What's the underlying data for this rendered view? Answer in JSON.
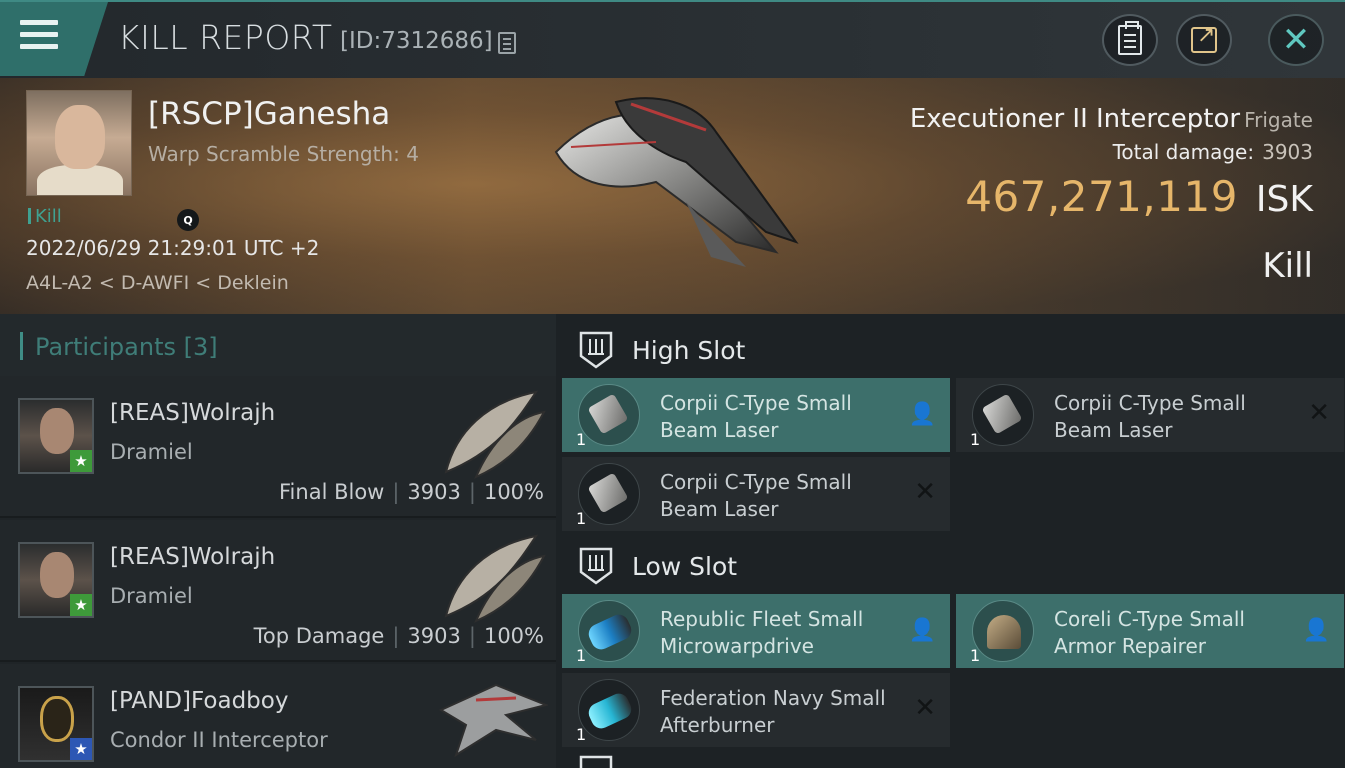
{
  "header": {
    "title": "KILL REPORT",
    "report_id": "[ID:7312686]"
  },
  "victim": {
    "name": "[RSCP]Ganesha",
    "detail": "Warp Scramble Strength: 4",
    "tag": "Kill",
    "datetime": "2022/06/29 21:29:01 UTC +2",
    "location": "A4L-A2 < D-AWFI < Deklein",
    "ship_name": "Executioner II Interceptor",
    "ship_class": "Frigate",
    "total_damage_label": "Total damage:",
    "total_damage": "3903",
    "isk_value": "467,271,119",
    "isk_unit": "ISK",
    "result": "Kill"
  },
  "participants": {
    "title": "Participants [3]",
    "rows": [
      {
        "name": "[REAS]Wolrajh",
        "ship": "Dramiel",
        "role": "Final Blow",
        "damage": "3903",
        "percent": "100%",
        "badge": "★",
        "badge_color": "#3e9a3a"
      },
      {
        "name": "[REAS]Wolrajh",
        "ship": "Dramiel",
        "role": "Top Damage",
        "damage": "3903",
        "percent": "100%",
        "badge": "★",
        "badge_color": "#3e9a3a"
      },
      {
        "name": "[PAND]Foadboy",
        "ship": "Condor II Interceptor",
        "role": "",
        "damage": "",
        "percent": "",
        "badge": "★",
        "badge_color": "#2d57b4"
      }
    ]
  },
  "fitting": {
    "high_slot": {
      "label": "High Slot",
      "modules": [
        {
          "qty": "1",
          "name": "Corpii C-Type Small Beam Laser",
          "state": "dropped"
        },
        {
          "qty": "1",
          "name": "Corpii C-Type Small Beam Laser",
          "state": "destroyed"
        },
        {
          "qty": "1",
          "name": "Corpii C-Type Small Beam Laser",
          "state": "destroyed"
        }
      ]
    },
    "low_slot": {
      "label": "Low Slot",
      "modules": [
        {
          "qty": "1",
          "name": "Republic Fleet Small Microwarpdrive",
          "state": "dropped"
        },
        {
          "qty": "1",
          "name": "Coreli C-Type Small Armor Repairer",
          "state": "dropped"
        },
        {
          "qty": "1",
          "name": "Federation Navy Small Afterburner",
          "state": "destroyed"
        }
      ]
    }
  },
  "icons": {
    "dropped": "person-icon",
    "destroyed": "x-icon",
    "colors": {
      "accent": "#3f8a84",
      "isk": "#e6b66a",
      "dropped_bg": "#3d6f6b"
    }
  }
}
